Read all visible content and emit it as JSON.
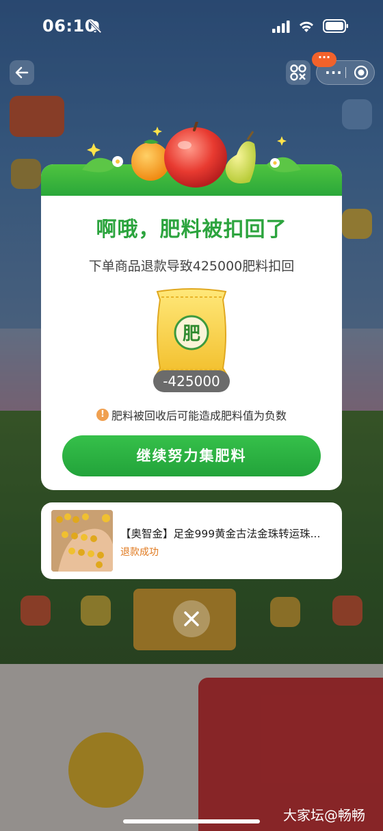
{
  "status_bar": {
    "time": "06:10"
  },
  "nav": {
    "more_label": "···",
    "badge": "···"
  },
  "modal": {
    "title": "啊哦，肥料被扣回了",
    "subtitle": "下单商品退款导致425000肥料扣回",
    "bag_label": "肥",
    "amount": "-425000",
    "warning_icon": "!",
    "warning": "肥料被回收后可能造成肥料值为负数",
    "cta": "继续努力集肥料"
  },
  "product": {
    "title": "【奥智金】足金999黄金古法金珠转运珠...",
    "status": "退款成功"
  },
  "watermark": "大家坛@畅畅",
  "colors": {
    "accent_green": "#2ca43e",
    "status_orange": "#e07a20",
    "badge_orange": "#f2622b"
  },
  "icons": [
    "bell-slash-icon",
    "signal-icon",
    "wifi-icon",
    "battery-icon",
    "back-arrow-icon",
    "qr-scan-icon",
    "more-icon",
    "target-close-icon",
    "warning-icon",
    "close-x-icon"
  ]
}
